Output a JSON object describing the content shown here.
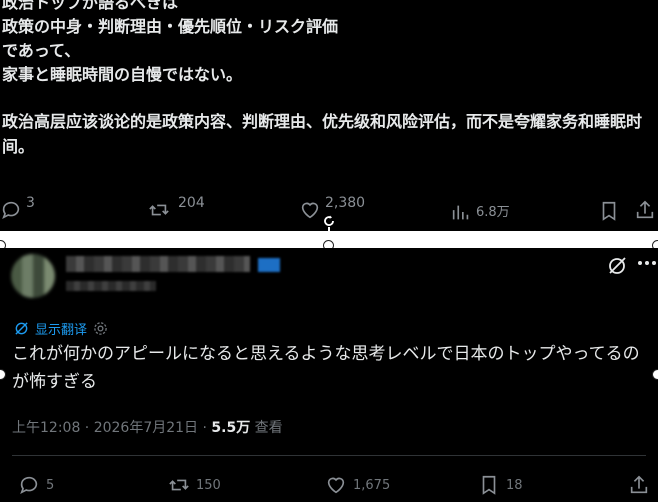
{
  "top_tweet": {
    "jp_lines": [
      "政治トップが語るべきは",
      "政策の中身・判断理由・優先順位・リスク評価",
      "であって、",
      "家事と睡眠時間の自慢ではない。"
    ],
    "zh_text": "政治高层应该谈论的是政策内容、判断理由、优先级和风险评估，而不是夸耀家务和睡眠时间。",
    "replies": "3",
    "reposts": "204",
    "likes": "2,380",
    "views": "6.8万"
  },
  "bottom_tweet": {
    "translate_label": "显示翻译",
    "text": "これが何かのアピールになると思えるような思考レベルで日本のトップやってるのが怖すぎる",
    "time": "上午12:08 · 2026年7月21日 · ",
    "views_num": "5.5万",
    "views_label": " 查看",
    "replies": "5",
    "reposts": "150",
    "likes": "1,675",
    "bookmarks": "18"
  },
  "colors": {
    "background": "#000000",
    "text": "#e7e9ea",
    "muted": "#71767b",
    "accent": "#1d9bf0"
  },
  "icons": [
    "reply-icon",
    "repost-icon",
    "like-icon",
    "views-icon",
    "bookmark-icon",
    "share-icon",
    "grok-icon",
    "more-icon",
    "translate-icon",
    "gear-icon",
    "rotate-icon"
  ]
}
